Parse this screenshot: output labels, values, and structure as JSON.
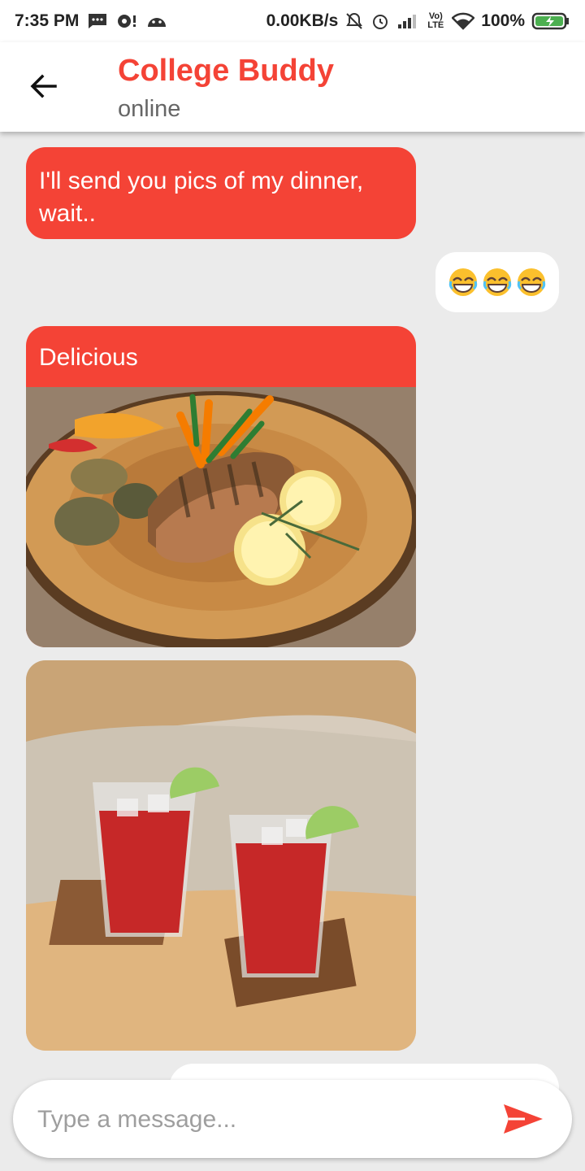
{
  "status_bar": {
    "time": "7:35 PM",
    "net_speed": "0.00KB/s",
    "volte": "Vo) LTE",
    "battery": "100%"
  },
  "header": {
    "title": "College Buddy",
    "status": "online"
  },
  "messages": {
    "m1": "I'll send you pics of my dinner, wait..",
    "m2_emojis": [
      "grinning-tears-emoji",
      "grinning-tears-emoji",
      "grinning-tears-emoji"
    ],
    "m3_caption": "Delicious",
    "m3_image": "grilled-chicken-plate-photo",
    "m4_image": "red-iced-drinks-photo"
  },
  "composer": {
    "placeholder": "Type a message..."
  },
  "colors": {
    "accent": "#f44336",
    "background": "#ebebeb",
    "bubble_white": "#ffffff"
  }
}
